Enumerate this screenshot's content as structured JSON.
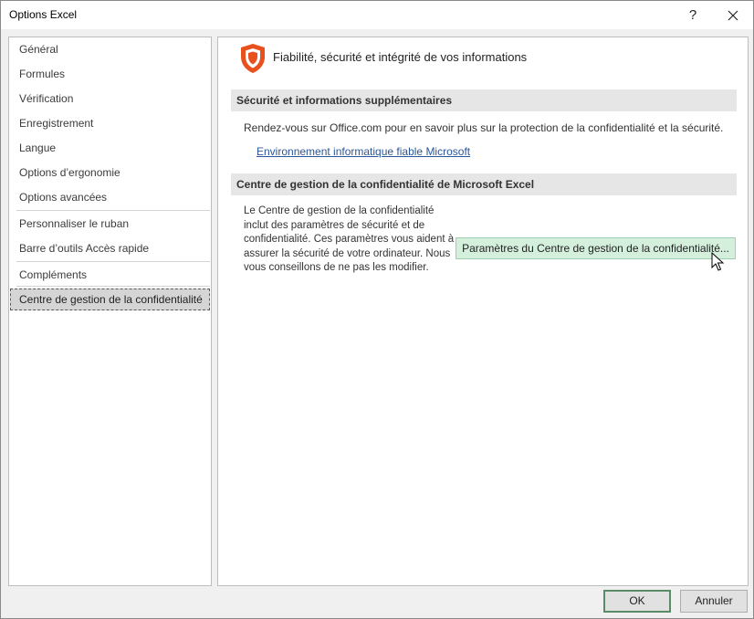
{
  "window": {
    "title": "Options Excel",
    "help_label": "?",
    "close_label": "✕"
  },
  "sidebar": {
    "items": [
      {
        "label": "Général"
      },
      {
        "label": "Formules"
      },
      {
        "label": "Vérification"
      },
      {
        "label": "Enregistrement"
      },
      {
        "label": "Langue"
      },
      {
        "label": "Options d’ergonomie"
      },
      {
        "label": "Options avancées"
      },
      {
        "label": "Personnaliser le ruban"
      },
      {
        "label": "Barre d’outils Accès rapide"
      },
      {
        "label": "Compléments"
      },
      {
        "label": "Centre de gestion de la confidentialité"
      }
    ],
    "selected": "Centre de gestion de la confidentialité"
  },
  "main": {
    "heading": "Fiabilité, sécurité et intégrité de vos informations",
    "section1": {
      "title": "Sécurité et informations supplémentaires",
      "text": "Rendez-vous sur Office.com pour en savoir plus sur la protection de la confidentialité et la sécurité.",
      "link": "Environnement informatique fiable Microsoft"
    },
    "section2": {
      "title": "Centre de gestion de la confidentialité de Microsoft Excel",
      "description": "Le Centre de gestion de la confidentialité inclut des paramètres de sécurité et de confidentialité. Ces paramètres vous aident à assurer la sécurité de votre ordinateur. Nous vous conseillons de ne pas les modifier.",
      "button": "Paramètres du Centre de gestion de la confidentialité..."
    }
  },
  "footer": {
    "ok_label": "OK",
    "cancel_label": "Annuler"
  },
  "colors": {
    "shield": "#e8501d",
    "accent_button": "#d4f0dc",
    "link": "#2b579a",
    "selected_nav": "#d5d5d5"
  },
  "icons": {
    "shield": "shield-icon",
    "cursor": "mouse-pointer-icon"
  }
}
